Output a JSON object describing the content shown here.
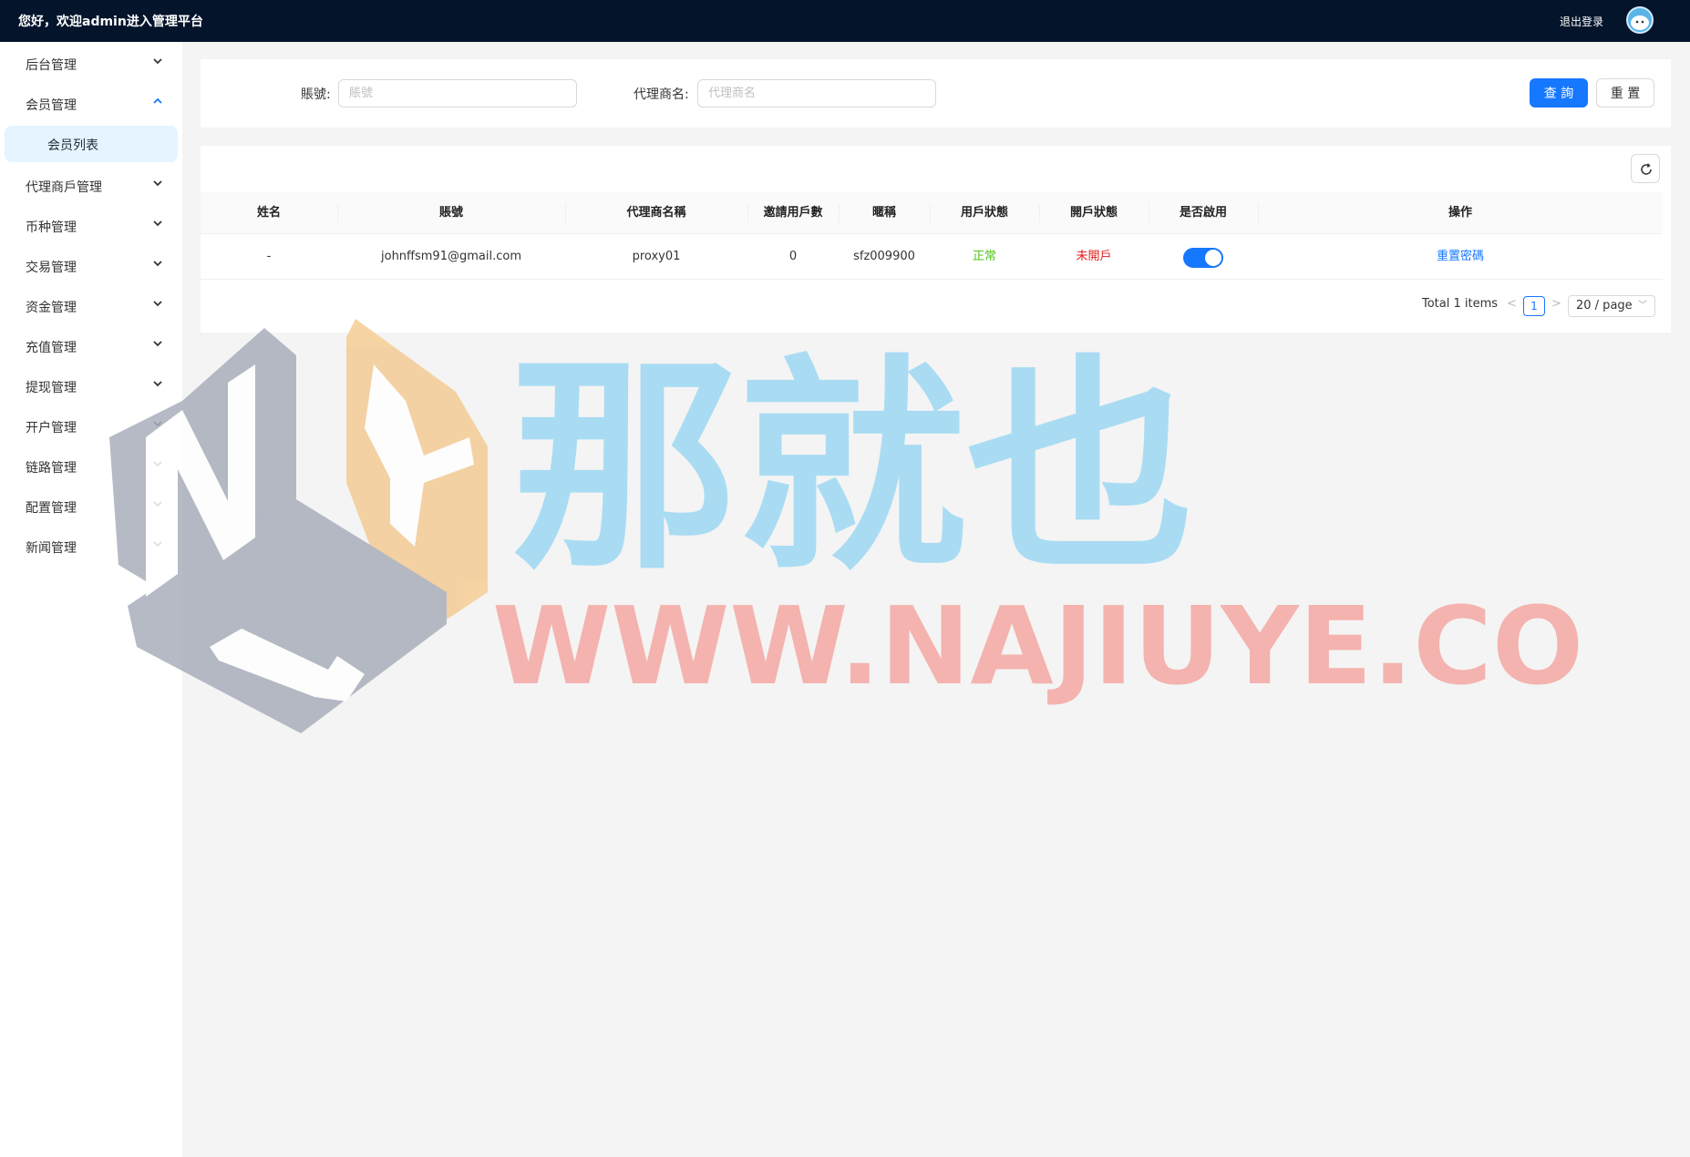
{
  "header": {
    "greeting": "您好，欢迎admin进入管理平台",
    "logout_label": "退出登录"
  },
  "sidebar": {
    "items": [
      {
        "label": "后台管理"
      },
      {
        "label": "会员管理"
      },
      {
        "label": "代理商戶管理"
      },
      {
        "label": "币种管理"
      },
      {
        "label": "交易管理"
      },
      {
        "label": "资金管理"
      },
      {
        "label": "充值管理"
      },
      {
        "label": "提现管理"
      },
      {
        "label": "开户管理"
      },
      {
        "label": "链路管理"
      },
      {
        "label": "配置管理"
      },
      {
        "label": "新闻管理"
      }
    ],
    "sub_item": "会员列表"
  },
  "search": {
    "account_label": "賬號:",
    "account_placeholder": "賬號",
    "agent_label": "代理商名:",
    "agent_placeholder": "代理商名",
    "query_button": "查 詢",
    "reset_button": "重 置"
  },
  "table": {
    "columns": [
      "姓名",
      "賬號",
      "代理商名稱",
      "邀請用戶數",
      "暱稱",
      "用戶狀態",
      "開戶狀態",
      "是否啟用",
      "操作"
    ],
    "rows": [
      {
        "name": "-",
        "account": "johnffsm91@gmail.com",
        "agent": "proxy01",
        "invites": "0",
        "nickname": "sfz009900",
        "user_status": "正常",
        "open_status": "未開戶",
        "enabled": true,
        "action": "重置密碼"
      }
    ]
  },
  "pagination": {
    "total": "Total 1 items",
    "prev": "<",
    "page": "1",
    "next": ">",
    "page_size": "20 / page"
  },
  "watermark": {
    "logo_letters": "NYJ",
    "brand_cn": "那就也",
    "url": "WWW.NAJIUYE.COM"
  },
  "colors": {
    "topbar": "#03142b",
    "primary": "#1677ff",
    "success": "#52c41a",
    "danger": "#e02020"
  }
}
